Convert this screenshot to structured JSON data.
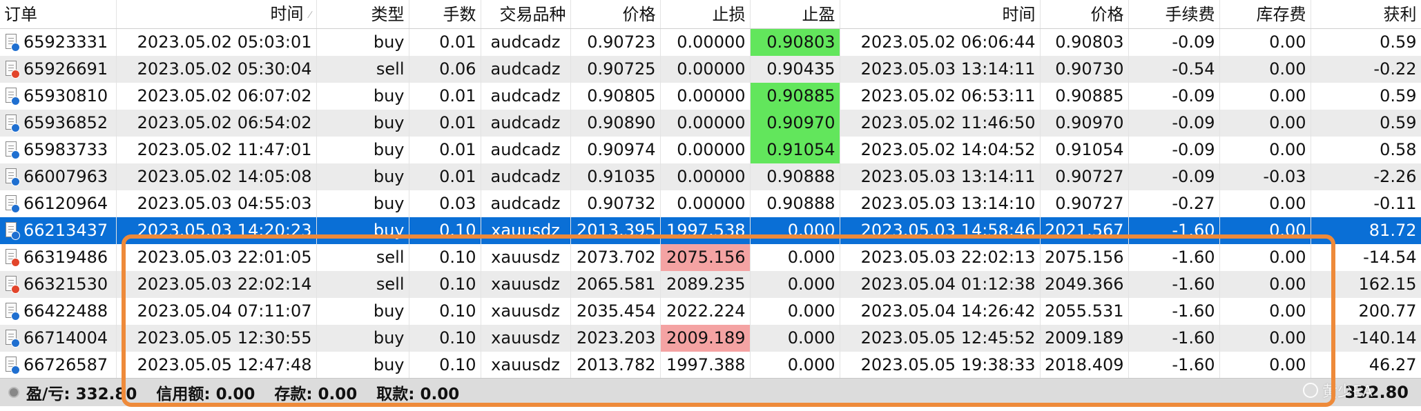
{
  "table": {
    "columns": [
      "订单",
      "时间",
      "类型",
      "手数",
      "交易品种",
      "价格",
      "止损",
      "止盈",
      "时间",
      "价格",
      "手续费",
      "库存费",
      "获利"
    ],
    "rows": [
      {
        "order": "65923331",
        "open_time": "2023.05.02 05:03:01",
        "type": "buy",
        "lots": "0.01",
        "symbol": "audcadz",
        "open_price": "0.90723",
        "sl": "0.00000",
        "tp": "0.90803",
        "close_time": "2023.05.02 06:06:44",
        "close_price": "0.90803",
        "commission": "-0.09",
        "swap": "0.00",
        "profit": "0.59"
      },
      {
        "order": "65926691",
        "open_time": "2023.05.02 05:30:04",
        "type": "sell",
        "lots": "0.06",
        "symbol": "audcadz",
        "open_price": "0.90725",
        "sl": "0.00000",
        "tp": "0.90435",
        "close_time": "2023.05.03 13:14:11",
        "close_price": "0.90730",
        "commission": "-0.54",
        "swap": "0.00",
        "profit": "-0.22"
      },
      {
        "order": "65930810",
        "open_time": "2023.05.02 06:07:02",
        "type": "buy",
        "lots": "0.01",
        "symbol": "audcadz",
        "open_price": "0.90805",
        "sl": "0.00000",
        "tp": "0.90885",
        "close_time": "2023.05.02 06:53:11",
        "close_price": "0.90885",
        "commission": "-0.09",
        "swap": "0.00",
        "profit": "0.59"
      },
      {
        "order": "65936852",
        "open_time": "2023.05.02 06:54:02",
        "type": "buy",
        "lots": "0.01",
        "symbol": "audcadz",
        "open_price": "0.90890",
        "sl": "0.00000",
        "tp": "0.90970",
        "close_time": "2023.05.02 11:46:50",
        "close_price": "0.90970",
        "commission": "-0.09",
        "swap": "0.00",
        "profit": "0.59"
      },
      {
        "order": "65983733",
        "open_time": "2023.05.02 11:47:01",
        "type": "buy",
        "lots": "0.01",
        "symbol": "audcadz",
        "open_price": "0.90974",
        "sl": "0.00000",
        "tp": "0.91054",
        "close_time": "2023.05.02 14:04:52",
        "close_price": "0.91054",
        "commission": "-0.09",
        "swap": "0.00",
        "profit": "0.58"
      },
      {
        "order": "66007963",
        "open_time": "2023.05.02 14:05:08",
        "type": "buy",
        "lots": "0.01",
        "symbol": "audcadz",
        "open_price": "0.91035",
        "sl": "0.00000",
        "tp": "0.90888",
        "close_time": "2023.05.03 13:14:11",
        "close_price": "0.90727",
        "commission": "-0.09",
        "swap": "-0.03",
        "profit": "-2.26"
      },
      {
        "order": "66120964",
        "open_time": "2023.05.03 04:55:03",
        "type": "buy",
        "lots": "0.03",
        "symbol": "audcadz",
        "open_price": "0.90732",
        "sl": "0.00000",
        "tp": "0.90888",
        "close_time": "2023.05.03 13:14:10",
        "close_price": "0.90727",
        "commission": "-0.27",
        "swap": "0.00",
        "profit": "-0.11"
      },
      {
        "order": "66213437",
        "open_time": "2023.05.03 14:20:23",
        "type": "buy",
        "lots": "0.10",
        "symbol": "xauusdz",
        "open_price": "2013.395",
        "sl": "1997.538",
        "tp": "0.000",
        "close_time": "2023.05.03 14:58:46",
        "close_price": "2021.567",
        "commission": "-1.60",
        "swap": "0.00",
        "profit": "81.72"
      },
      {
        "order": "66319486",
        "open_time": "2023.05.03 22:01:05",
        "type": "sell",
        "lots": "0.10",
        "symbol": "xauusdz",
        "open_price": "2073.702",
        "sl": "2075.156",
        "tp": "0.000",
        "close_time": "2023.05.03 22:02:13",
        "close_price": "2075.156",
        "commission": "-1.60",
        "swap": "0.00",
        "profit": "-14.54"
      },
      {
        "order": "66321530",
        "open_time": "2023.05.03 22:02:14",
        "type": "sell",
        "lots": "0.10",
        "symbol": "xauusdz",
        "open_price": "2065.581",
        "sl": "2089.235",
        "tp": "0.000",
        "close_time": "2023.05.04 01:12:38",
        "close_price": "2049.366",
        "commission": "-1.60",
        "swap": "0.00",
        "profit": "162.15"
      },
      {
        "order": "66422488",
        "open_time": "2023.05.04 07:11:07",
        "type": "buy",
        "lots": "0.10",
        "symbol": "xauusdz",
        "open_price": "2035.454",
        "sl": "2022.224",
        "tp": "0.000",
        "close_time": "2023.05.04 14:26:42",
        "close_price": "2055.531",
        "commission": "-1.60",
        "swap": "0.00",
        "profit": "200.77"
      },
      {
        "order": "66714004",
        "open_time": "2023.05.05 12:30:55",
        "type": "buy",
        "lots": "0.10",
        "symbol": "xauusdz",
        "open_price": "2023.203",
        "sl": "2009.189",
        "tp": "0.000",
        "close_time": "2023.05.05 12:45:52",
        "close_price": "2009.189",
        "commission": "-1.60",
        "swap": "0.00",
        "profit": "-140.14"
      },
      {
        "order": "66726587",
        "open_time": "2023.05.05 12:47:48",
        "type": "buy",
        "lots": "0.10",
        "symbol": "xauusdz",
        "open_price": "2013.782",
        "sl": "1997.388",
        "tp": "0.000",
        "close_time": "2023.05.05 19:38:33",
        "close_price": "2018.409",
        "commission": "-1.60",
        "swap": "0.00",
        "profit": "46.27"
      }
    ],
    "selected_row_index": 7,
    "highlights": {
      "tp_green_rows": [
        0,
        2,
        3,
        4
      ],
      "sl_red_rows": [
        8,
        11
      ]
    }
  },
  "status_bar": {
    "pnl": "盈/亏: 332.80",
    "credit": "信用额: 0.00",
    "deposit": "存款: 0.00",
    "withdrawal": "取款: 0.00",
    "total": "332.80"
  },
  "watermark": "黄少EA",
  "colors": {
    "selected_row": "#0a6fd6",
    "tp_highlight": "#62e65c",
    "sl_highlight": "#f4a3a3",
    "annotation_box": "#ee8a3a",
    "buy_icon": "#1f6fd0",
    "sell_icon": "#e2452b"
  }
}
